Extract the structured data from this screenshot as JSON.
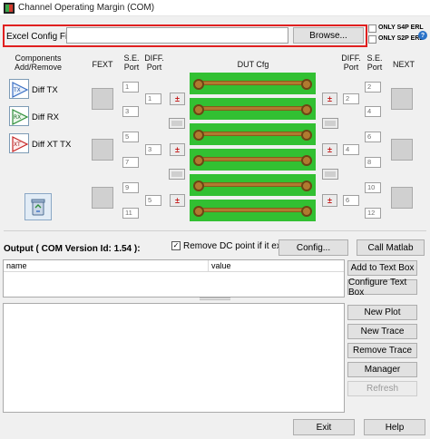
{
  "window": {
    "title": "Channel Operating Margin (COM)"
  },
  "config": {
    "excel_label": "Excel Config File:",
    "excel_value": "",
    "browse_label": "Browse...",
    "only_s4p_label": "ONLY S4P ERL",
    "only_s2p_label": "ONLY S2P ERL",
    "help_glyph": "?"
  },
  "headers": {
    "components": "Components Add/Remove",
    "fext": "FEXT",
    "se_port_left": "S.E. Port",
    "diff_port_left": "DIFF. Port",
    "dut_cfg": "DUT Cfg",
    "diff_port_right": "DIFF. Port",
    "se_port_right": "S.E. Port",
    "next": "NEXT"
  },
  "components": [
    {
      "icon": "TX",
      "label": "Diff TX"
    },
    {
      "icon": "RX",
      "label": "Diff RX"
    },
    {
      "icon": "XT",
      "label": "Diff XT TX"
    }
  ],
  "ports": {
    "se_left": [
      "1",
      "3",
      "5",
      "7",
      "9",
      "11"
    ],
    "diff_left": [
      "1",
      "3",
      "5"
    ],
    "diff_right": [
      "2",
      "4",
      "6"
    ],
    "se_right": [
      "2",
      "4",
      "6",
      "8",
      "10",
      "12"
    ],
    "polarity_glyph": "±"
  },
  "output": {
    "title": "Output ( COM Version Id: 1.54 ):",
    "remove_dc_checked": "✓",
    "remove_dc_label": "Remove DC point if it exists",
    "config_label": "Config...",
    "call_matlab_label": "Call Matlab",
    "table_headers": {
      "name": "name",
      "value": "value"
    },
    "add_to_text_box": "Add to Text Box",
    "configure_text_box": "Configure Text Box"
  },
  "plot_buttons": {
    "new_plot": "New Plot",
    "new_trace": "New Trace",
    "remove_trace": "Remove Trace",
    "manager": "Manager",
    "refresh": "Refresh"
  },
  "footer": {
    "exit": "Exit",
    "help": "Help"
  },
  "colors": {
    "dut_green": "#32c032",
    "trace_copper": "#b07a30",
    "highlight_red": "#e02020",
    "help_blue": "#2a72c8"
  }
}
